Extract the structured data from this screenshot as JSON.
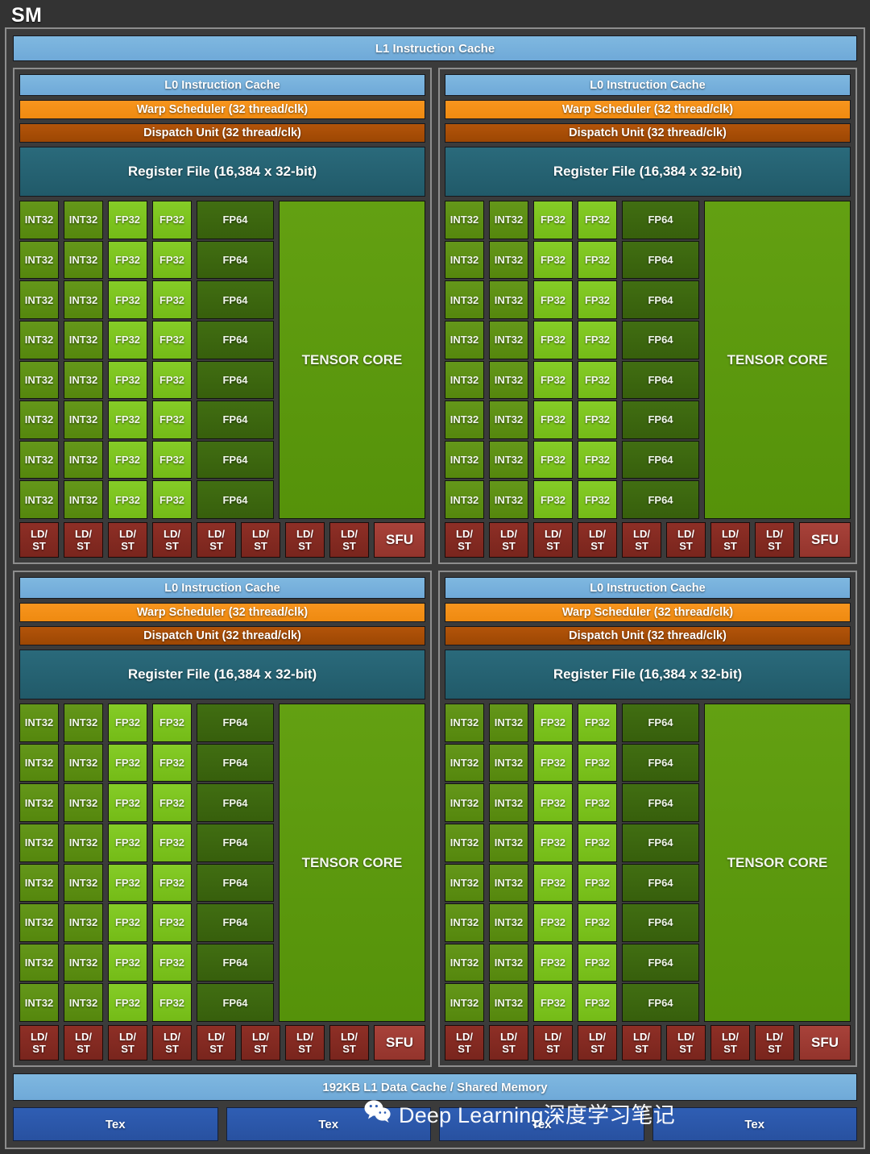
{
  "chip": {
    "title": "SM",
    "l1_instruction_cache": "L1 Instruction Cache",
    "l1_data_cache": "192KB L1 Data Cache / Shared Memory"
  },
  "processing_block": {
    "l0_instruction_cache": "L0 Instruction Cache",
    "warp_scheduler": "Warp Scheduler (32 thread/clk)",
    "dispatch_unit": "Dispatch Unit (32 thread/clk)",
    "register_file": "Register File (16,384 x 32-bit)",
    "tensor_core": "TENSOR CORE",
    "sfu": "SFU",
    "ldst_line1": "LD/",
    "ldst_line2": "ST",
    "int32": "INT32",
    "fp32": "FP32",
    "fp64": "FP64",
    "core_rows": 8,
    "int32_columns": 2,
    "fp32_columns": 2,
    "fp64_columns": 1,
    "ldst_count": 8,
    "sfu_count": 1
  },
  "processing_blocks": [
    {
      "id": "top-left"
    },
    {
      "id": "top-right"
    },
    {
      "id": "bottom-left"
    },
    {
      "id": "bottom-right"
    }
  ],
  "tex_units": [
    {
      "label": "Tex"
    },
    {
      "label": "Tex"
    },
    {
      "label": "Tex"
    },
    {
      "label": "Tex"
    }
  ],
  "watermark": {
    "text": "Deep Learning深度学习笔记",
    "icon": "wechat-icon"
  },
  "colors": {
    "background": "#333333",
    "panel": "#3b3b3b",
    "border": "#8d8d8d",
    "cache_blue": "#6fa9d8",
    "warp_orange": "#f7951e",
    "dispatch_brown": "#b2540a",
    "register_teal": "#2a6a7b",
    "int32_green": "#64971a",
    "fp32_green": "#85cc27",
    "fp64_green": "#416e12",
    "tensor_green": "#63a012",
    "ldst_red": "#8e2f26",
    "sfu_red": "#a8423a",
    "tex_blue": "#2f5eb4"
  }
}
